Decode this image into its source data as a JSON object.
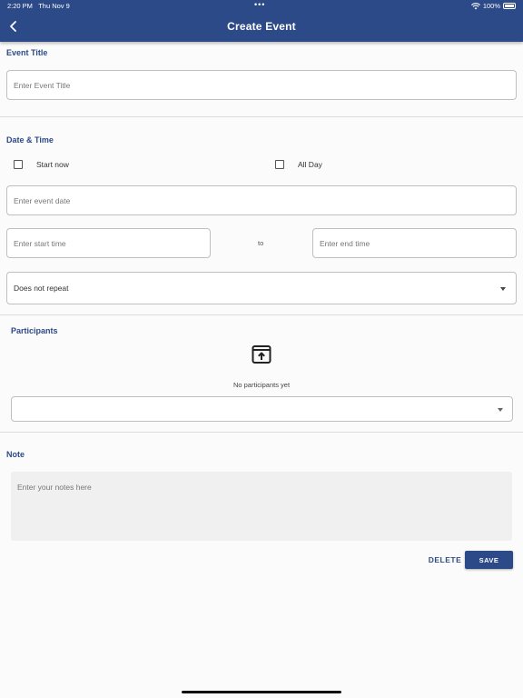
{
  "status_bar": {
    "time": "2:20 PM",
    "date": "Thu Nov 9",
    "dots": "•••",
    "battery": "100%"
  },
  "nav": {
    "title": "Create Event"
  },
  "event_title": {
    "label": "Event Title",
    "placeholder": "Enter Event Title"
  },
  "date_time": {
    "label": "Date & Time",
    "start_now_label": "Start now",
    "all_day_label": "All Day",
    "date_placeholder": "Enter event date",
    "start_placeholder": "Enter start time",
    "to_label": "to",
    "end_placeholder": "Enter end time",
    "repeat_value": "Does not repeat"
  },
  "participants": {
    "label": "Participants",
    "empty_text": "No participants yet"
  },
  "note": {
    "label": "Note",
    "placeholder": "Enter your notes here"
  },
  "actions": {
    "delete_label": "DELETE",
    "save_label": "SAVE"
  },
  "colors": {
    "primary": "#2c4a87",
    "background": "#fbfbfb",
    "border": "#bfbfbf"
  }
}
